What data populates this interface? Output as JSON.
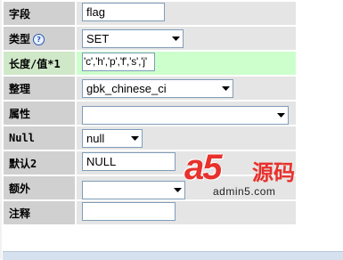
{
  "fields": {
    "field_name": {
      "label": "字段",
      "value": "flag"
    },
    "type": {
      "label": "类型",
      "help": "?",
      "value": "SET"
    },
    "length": {
      "label": "长度/值*1",
      "value": "'c','h','p','f','s','j'"
    },
    "collation": {
      "label": "整理",
      "value": "gbk_chinese_ci"
    },
    "attributes": {
      "label": "属性",
      "value": ""
    },
    "null": {
      "label": "Null",
      "value": "null"
    },
    "default": {
      "label": "默认2",
      "value": "NULL"
    },
    "extra": {
      "label": "额外",
      "value": ""
    },
    "comment": {
      "label": "注释",
      "value": ""
    }
  },
  "watermark": {
    "brand": "a5",
    "brand_cn": "源码",
    "url": "admin5.com"
  },
  "colors": {
    "highlight_row": "#ccffcc",
    "label_bg": "#d0d0d0",
    "value_bg": "#e5e5e5",
    "watermark": "#e8312c"
  }
}
